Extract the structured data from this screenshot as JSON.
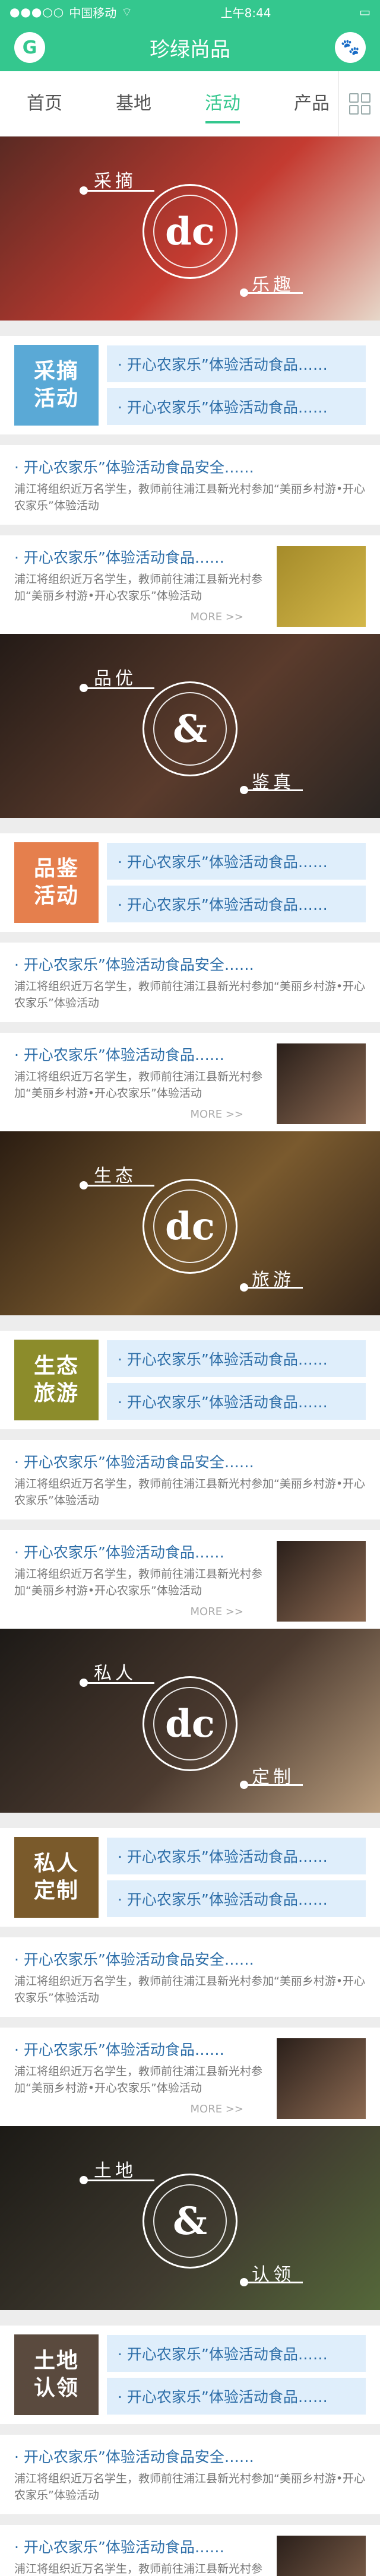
{
  "status": {
    "signal": "●●●○○",
    "carrier": "中国移动",
    "wifi": "⌔",
    "time": "上午8:44",
    "battery": "▭"
  },
  "header": {
    "title": "珍绿尚品",
    "left_icon": "G",
    "right_icon": "🐾"
  },
  "nav": {
    "tabs": [
      "首页",
      "基地",
      "活动",
      "产品"
    ],
    "active": 2
  },
  "sections": [
    {
      "w1": "采摘",
      "w2": "乐趣",
      "logo": "dc",
      "badge1": "采摘",
      "badge2": "活动",
      "badge_color": "#5aa9d6",
      "banner_colors": [
        "#5a2a23",
        "#c43b31",
        "#e7d7c9"
      ],
      "thumb_colors": [
        "#a58b2a",
        "#d4b84a"
      ]
    },
    {
      "w1": "品优",
      "w2": "鉴真",
      "logo": "&",
      "badge1": "品鉴",
      "badge2": "活动",
      "badge_color": "#e57f4d",
      "banner_colors": [
        "#241b17",
        "#5a3b2c",
        "#2a2522"
      ],
      "thumb_colors": [
        "#2a1f1a",
        "#8c6a52"
      ]
    },
    {
      "w1": "生态",
      "w2": "旅游",
      "logo": "dc",
      "badge1": "生态",
      "badge2": "旅游",
      "badge_color": "#8c8c2b",
      "banner_colors": [
        "#2b1d12",
        "#7a5a2e",
        "#35261a"
      ],
      "thumb_colors": [
        "#2a1f1a",
        "#8c6a52"
      ]
    },
    {
      "w1": "私人",
      "w2": "定制",
      "logo": "dc",
      "badge1": "私人",
      "badge2": "定制",
      "badge_color": "#7a5a2b",
      "banner_colors": [
        "#1d1a17",
        "#4b3a2f",
        "#b89c7d"
      ],
      "thumb_colors": [
        "#2a1f1a",
        "#8c6a52"
      ]
    },
    {
      "w1": "土地",
      "w2": "认领",
      "logo": "&",
      "badge1": "土地",
      "badge2": "认领",
      "badge_color": "#5a4a3e",
      "banner_colors": [
        "#1c1a16",
        "#3f3a2f",
        "#55683a"
      ],
      "thumb_colors": [
        "#2a1f1a",
        "#8c6a52"
      ]
    }
  ],
  "link_text": "· 开心农家乐”体验活动食品……",
  "article1": {
    "title": "· 开心农家乐”体验活动食品安全……",
    "desc": "浦江将组织近万名学生，教师前往浦江县新光村参加“美丽乡村游•开心农家乐”体验活动"
  },
  "article2": {
    "title": "· 开心农家乐”体验活动食品……",
    "desc": "浦江将组织近万名学生，教师前往浦江县新光村参加“美丽乡村游•开心农家乐”体验活动",
    "more": "MORE >>"
  }
}
